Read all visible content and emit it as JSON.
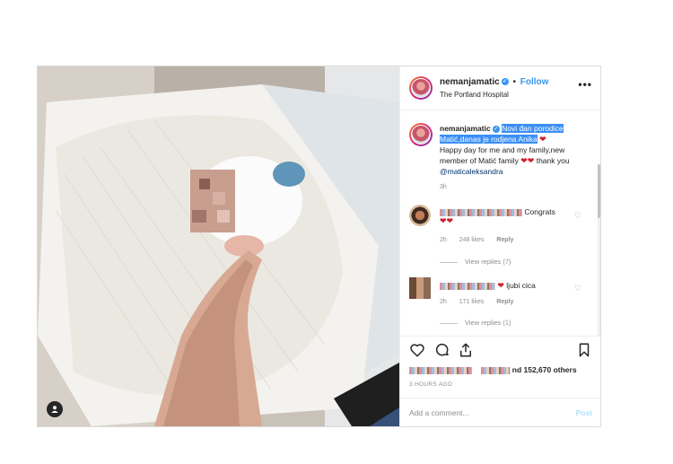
{
  "header": {
    "username": "nemanjamatic",
    "separator": "•",
    "follow_label": "Follow",
    "location": "The Portland Hospital",
    "more_label": "•••"
  },
  "caption": {
    "username": "nemanjamatic",
    "highlighted": "Novi đan porodice Matić,danas je rodjena Anika",
    "text": "Happy day for me and my family,new member of Matić family",
    "thank": "thank you",
    "mention": "@maticaleksandra",
    "time": "3h"
  },
  "comments": [
    {
      "text": "Congrats",
      "time": "2h",
      "likes": "248 likes",
      "reply_label": "Reply",
      "view_replies": "View replies (7)"
    },
    {
      "text": "ljubi cica",
      "time": "2h",
      "likes": "171 likes",
      "reply_label": "Reply",
      "view_replies": "View replies (1)"
    }
  ],
  "actions": {
    "icons": [
      "heart-outline-icon",
      "comment-icon",
      "share-icon",
      "bookmark-icon"
    ],
    "likes_suffix": "nd 152,670 others",
    "time_ago": "3 HOURS AGO"
  },
  "add_comment": {
    "placeholder": "Add a comment...",
    "post_label": "Post"
  },
  "colors": {
    "accent": "#3897f0",
    "highlight": "#3b8ff5",
    "heart": "#d01f2f",
    "muted": "#8e8e8e"
  }
}
